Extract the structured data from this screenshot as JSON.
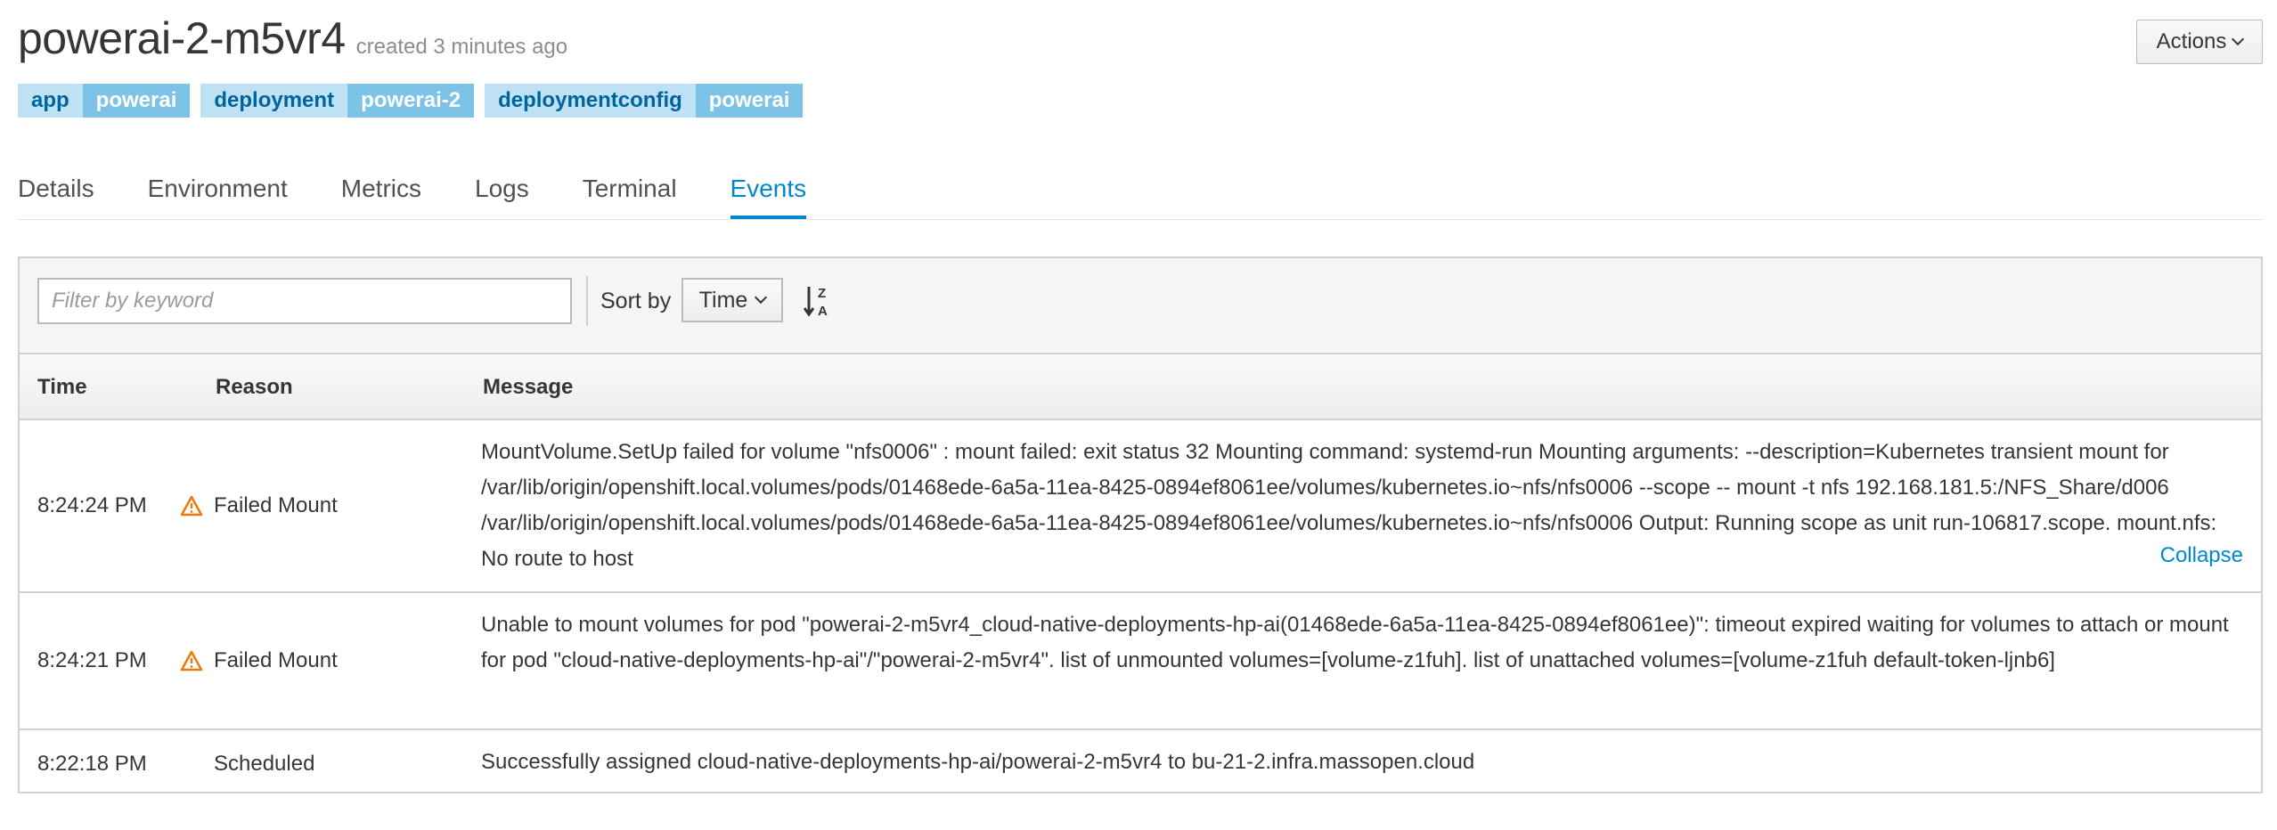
{
  "header": {
    "title": "powerai-2-m5vr4",
    "created": "created 3 minutes ago",
    "actions_label": "Actions"
  },
  "labels": [
    {
      "key": "app",
      "value": "powerai"
    },
    {
      "key": "deployment",
      "value": "powerai-2"
    },
    {
      "key": "deploymentconfig",
      "value": "powerai"
    }
  ],
  "tabs": [
    {
      "label": "Details"
    },
    {
      "label": "Environment"
    },
    {
      "label": "Metrics"
    },
    {
      "label": "Logs"
    },
    {
      "label": "Terminal"
    },
    {
      "label": "Events",
      "active": true
    }
  ],
  "toolbar": {
    "filter_placeholder": "Filter by keyword",
    "sort_by_label": "Sort by",
    "sort_value": "Time",
    "sort_direction_icon": "sort-alpha-desc-icon"
  },
  "table": {
    "columns": [
      "Time",
      "Reason",
      "Message"
    ],
    "rows": [
      {
        "time": "8:24:24 PM",
        "reason": "Failed Mount",
        "warning": true,
        "message": "MountVolume.SetUp failed for volume \"nfs0006\" : mount failed: exit status 32 Mounting command: systemd-run Mounting arguments: --description=Kubernetes transient mount for /var/lib/origin/openshift.local.volumes/pods/01468ede-6a5a-11ea-8425-0894ef8061ee/volumes/kubernetes.io~nfs/nfs0006 --scope -- mount -t nfs 192.168.181.5:/NFS_Share/d006 /var/lib/origin/openshift.local.volumes/pods/01468ede-6a5a-11ea-8425-0894ef8061ee/volumes/kubernetes.io~nfs/nfs0006 Output: Running scope as unit run-106817.scope. mount.nfs: No route to host",
        "collapse_label": "Collapse"
      },
      {
        "time": "8:24:21 PM",
        "reason": "Failed Mount",
        "warning": true,
        "message": "Unable to mount volumes for pod \"powerai-2-m5vr4_cloud-native-deployments-hp-ai(01468ede-6a5a-11ea-8425-0894ef8061ee)\": timeout expired waiting for volumes to attach or mount for pod \"cloud-native-deployments-hp-ai\"/\"powerai-2-m5vr4\". list of unmounted volumes=[volume-z1fuh]. list of unattached volumes=[volume-z1fuh default-token-ljnb6]"
      },
      {
        "time": "8:22:18 PM",
        "reason": "Scheduled",
        "warning": false,
        "message": "Successfully assigned cloud-native-deployments-hp-ai/powerai-2-m5vr4 to bu-21-2.infra.massopen.cloud"
      }
    ]
  },
  "colors": {
    "accent": "#0088ce",
    "label_key_bg": "#bee1f4",
    "label_value_bg": "#7dc3e8",
    "warning": "#ec7a08"
  }
}
